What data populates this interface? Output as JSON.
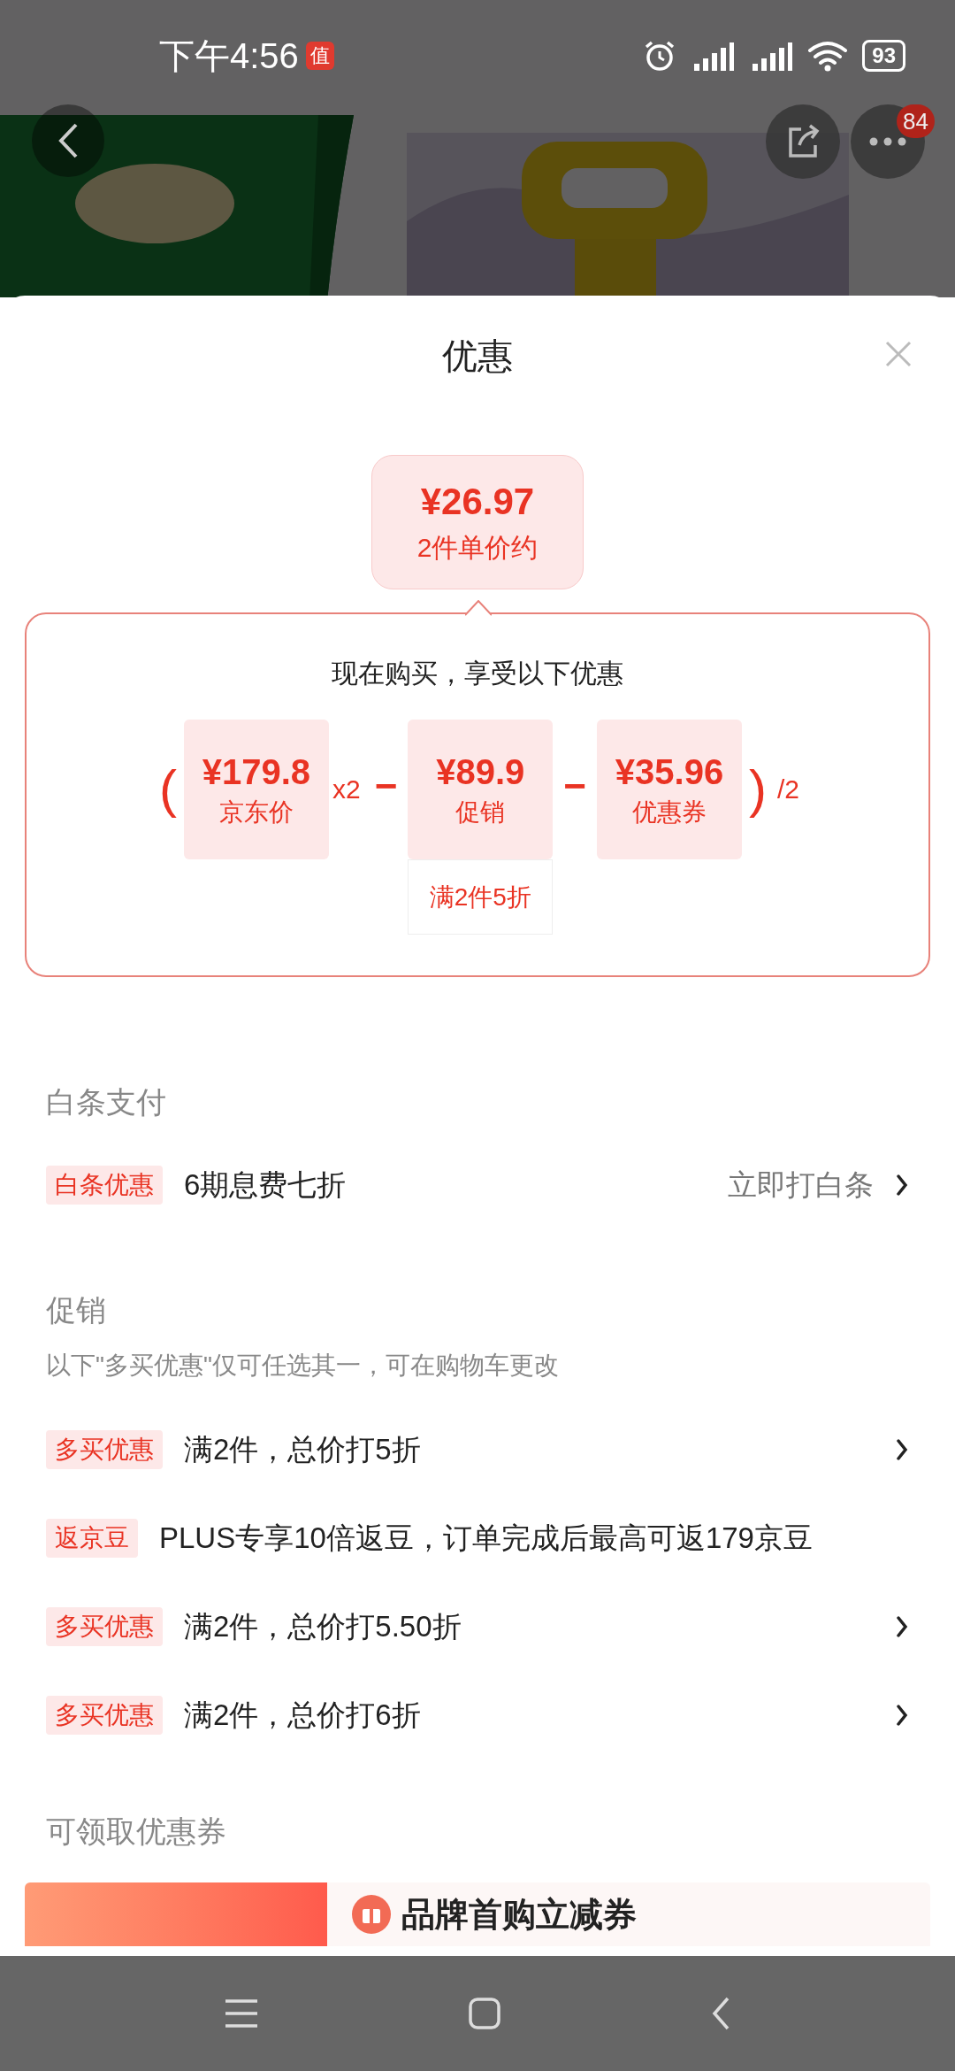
{
  "status_bar": {
    "time": "下午4:56",
    "notification": "值",
    "battery": "93"
  },
  "header": {
    "more_badge": "84"
  },
  "sheet": {
    "title": "优惠"
  },
  "price_bubble": {
    "price": "¥26.97",
    "caption": "2件单价约"
  },
  "breakdown": {
    "heading": "现在购买，享受以下优惠",
    "formula": [
      {
        "kind": "paren",
        "text": "("
      },
      {
        "kind": "box",
        "price": "¥179.8",
        "label": "京东价"
      },
      {
        "kind": "op",
        "text": "x2"
      },
      {
        "kind": "minus",
        "text": "−"
      },
      {
        "kind": "box",
        "price": "¥89.9",
        "label": "促销",
        "note": "满2件5折"
      },
      {
        "kind": "minus",
        "text": "−"
      },
      {
        "kind": "box",
        "price": "¥35.96",
        "label": "优惠券"
      },
      {
        "kind": "paren",
        "text": ")"
      },
      {
        "kind": "op",
        "text": "/2"
      }
    ]
  },
  "baitiao": {
    "title": "白条支付",
    "rows": [
      {
        "tag": "白条优惠",
        "text": "6期息费七折",
        "action": "立即打白条"
      }
    ]
  },
  "promotions": {
    "title": "促销",
    "note": "以下\"多买优惠\"仅可任选其一，可在购物车更改",
    "rows": [
      {
        "tag": "多买优惠",
        "text": "满2件，总价打5折",
        "chevron": true
      },
      {
        "tag": "返京豆",
        "text": "PLUS专享10倍返豆，订单完成后最高可返179京豆",
        "chevron": false
      },
      {
        "tag": "多买优惠",
        "text": "满2件，总价打5.50折",
        "chevron": true
      },
      {
        "tag": "多买优惠",
        "text": "满2件，总价打6折",
        "chevron": true
      }
    ]
  },
  "coupons": {
    "title": "可领取优惠券",
    "items": [
      {
        "title": "品牌首购立减券"
      }
    ]
  }
}
